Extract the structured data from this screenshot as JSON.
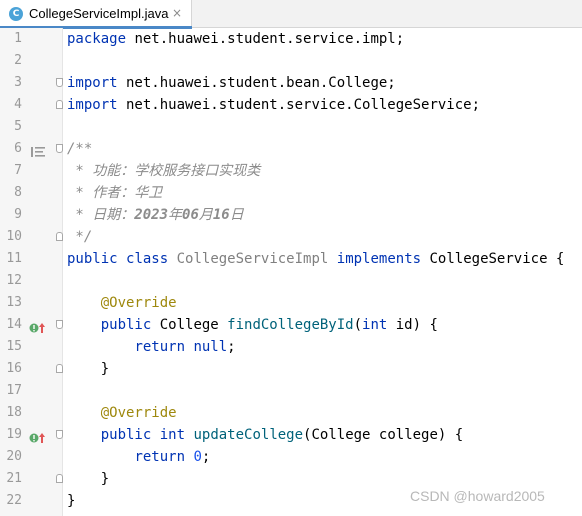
{
  "tab": {
    "filename": "CollegeServiceImpl.java",
    "class_icon_letter": "C",
    "close_glyph": "×"
  },
  "colors": {
    "keyword": "#0033b3",
    "annotation": "#9e880d",
    "method": "#00627a",
    "number": "#1750eb",
    "comment": "#8c8c8c",
    "accent": "#4a88c7"
  },
  "lines": [
    {
      "n": "1",
      "gutter": "",
      "tokens": [
        {
          "t": "package",
          "c": "kw"
        },
        {
          "t": " net.huawei.student.service.impl;",
          "c": ""
        }
      ]
    },
    {
      "n": "2",
      "gutter": "",
      "tokens": []
    },
    {
      "n": "3",
      "gutter": "fold-open",
      "tokens": [
        {
          "t": "import",
          "c": "kw"
        },
        {
          "t": " net.huawei.student.bean.College;",
          "c": ""
        }
      ]
    },
    {
      "n": "4",
      "gutter": "fold-close",
      "tokens": [
        {
          "t": "import",
          "c": "kw"
        },
        {
          "t": " net.huawei.student.service.CollegeService;",
          "c": ""
        }
      ]
    },
    {
      "n": "5",
      "gutter": "",
      "tokens": []
    },
    {
      "n": "6",
      "gutter": "fold-open doc",
      "tokens": [
        {
          "t": "/**",
          "c": "doc"
        }
      ]
    },
    {
      "n": "7",
      "gutter": "",
      "tokens": [
        {
          "t": " * 功能：学校服务接口实现类",
          "c": "doc"
        }
      ]
    },
    {
      "n": "8",
      "gutter": "",
      "tokens": [
        {
          "t": " * 作者：华卫",
          "c": "doc"
        }
      ]
    },
    {
      "n": "9",
      "gutter": "",
      "tokens": [
        {
          "t": " * 日期：",
          "c": "doc"
        },
        {
          "t": "2023",
          "c": "docb"
        },
        {
          "t": "年",
          "c": "doc"
        },
        {
          "t": "06",
          "c": "docb"
        },
        {
          "t": "月",
          "c": "doc"
        },
        {
          "t": "16",
          "c": "docb"
        },
        {
          "t": "日",
          "c": "doc"
        }
      ]
    },
    {
      "n": "10",
      "gutter": "fold-close",
      "tokens": [
        {
          "t": " */",
          "c": "doc"
        }
      ]
    },
    {
      "n": "11",
      "gutter": "",
      "tokens": [
        {
          "t": "public",
          "c": "kw"
        },
        {
          "t": " ",
          "c": ""
        },
        {
          "t": "class",
          "c": "kw"
        },
        {
          "t": " ",
          "c": ""
        },
        {
          "t": "CollegeServiceImpl",
          "c": "unused"
        },
        {
          "t": " ",
          "c": ""
        },
        {
          "t": "implements",
          "c": "kw"
        },
        {
          "t": " CollegeService {",
          "c": ""
        }
      ]
    },
    {
      "n": "12",
      "gutter": "",
      "tokens": []
    },
    {
      "n": "13",
      "gutter": "",
      "tokens": [
        {
          "t": "    ",
          "c": ""
        },
        {
          "t": "@Override",
          "c": "ann"
        }
      ]
    },
    {
      "n": "14",
      "gutter": "fold-open impl",
      "tokens": [
        {
          "t": "    ",
          "c": ""
        },
        {
          "t": "public",
          "c": "kw"
        },
        {
          "t": " College ",
          "c": ""
        },
        {
          "t": "findCollegeById",
          "c": "method"
        },
        {
          "t": "(",
          "c": ""
        },
        {
          "t": "int",
          "c": "kw"
        },
        {
          "t": " id) {",
          "c": ""
        }
      ]
    },
    {
      "n": "15",
      "gutter": "",
      "tokens": [
        {
          "t": "        ",
          "c": ""
        },
        {
          "t": "return",
          "c": "kw"
        },
        {
          "t": " ",
          "c": ""
        },
        {
          "t": "null",
          "c": "kw"
        },
        {
          "t": ";",
          "c": ""
        }
      ]
    },
    {
      "n": "16",
      "gutter": "fold-close",
      "tokens": [
        {
          "t": "    }",
          "c": ""
        }
      ]
    },
    {
      "n": "17",
      "gutter": "",
      "tokens": []
    },
    {
      "n": "18",
      "gutter": "",
      "tokens": [
        {
          "t": "    ",
          "c": ""
        },
        {
          "t": "@Override",
          "c": "ann"
        }
      ]
    },
    {
      "n": "19",
      "gutter": "fold-open impl",
      "tokens": [
        {
          "t": "    ",
          "c": ""
        },
        {
          "t": "public",
          "c": "kw"
        },
        {
          "t": " ",
          "c": ""
        },
        {
          "t": "int",
          "c": "kw"
        },
        {
          "t": " ",
          "c": ""
        },
        {
          "t": "updateCollege",
          "c": "method"
        },
        {
          "t": "(College college) {",
          "c": ""
        }
      ]
    },
    {
      "n": "20",
      "gutter": "",
      "tokens": [
        {
          "t": "        ",
          "c": ""
        },
        {
          "t": "return",
          "c": "kw"
        },
        {
          "t": " ",
          "c": ""
        },
        {
          "t": "0",
          "c": "num"
        },
        {
          "t": ";",
          "c": ""
        }
      ]
    },
    {
      "n": "21",
      "gutter": "fold-close",
      "tokens": [
        {
          "t": "    }",
          "c": ""
        }
      ]
    },
    {
      "n": "22",
      "gutter": "",
      "tokens": [
        {
          "t": "}",
          "c": ""
        }
      ]
    }
  ],
  "watermark": "CSDN @howard2005"
}
